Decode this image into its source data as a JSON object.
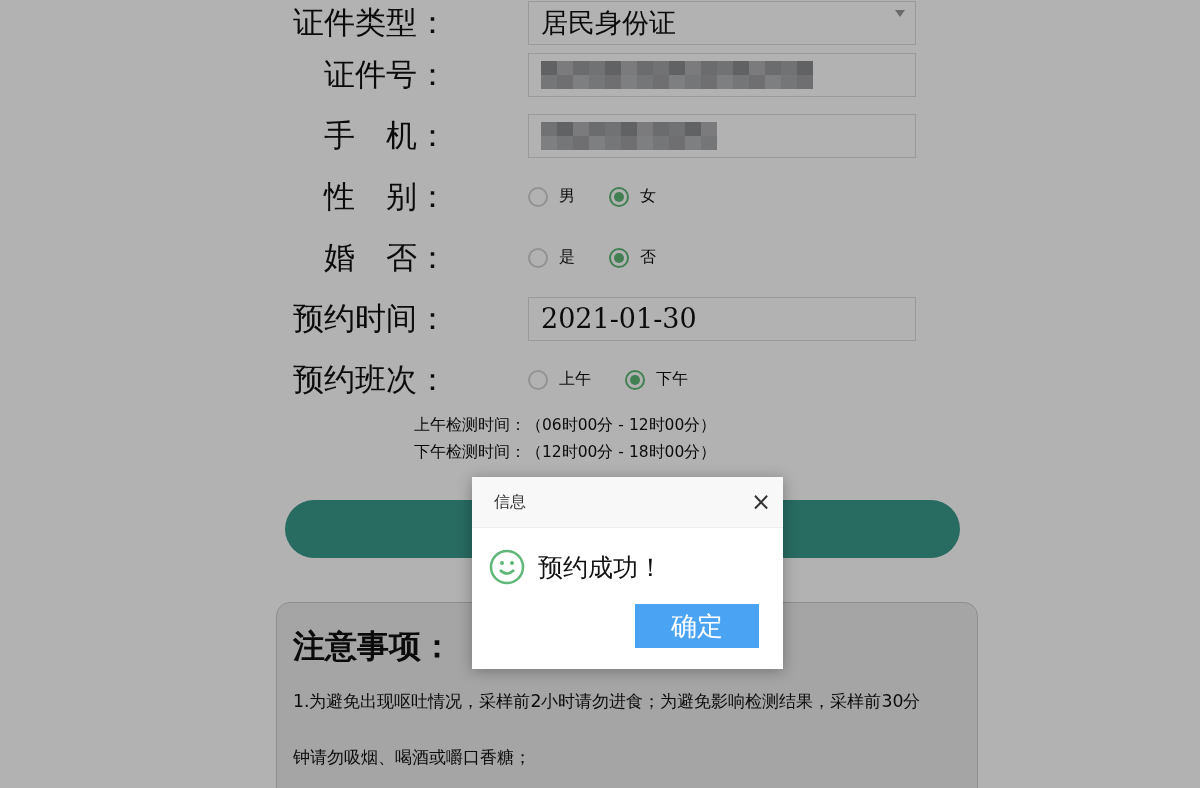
{
  "form": {
    "fields": [
      {
        "label": "证件类型：",
        "kind": "select",
        "value": "居民身份证"
      },
      {
        "label": "证件号：",
        "kind": "redacted"
      },
      {
        "label": "手　机：",
        "kind": "redacted"
      },
      {
        "label": "性　别：",
        "kind": "radio",
        "options": [
          {
            "label": "男",
            "selected": false
          },
          {
            "label": "女",
            "selected": true
          }
        ]
      },
      {
        "label": "婚　否：",
        "kind": "radio",
        "options": [
          {
            "label": "是",
            "selected": false
          },
          {
            "label": "否",
            "selected": true
          }
        ]
      },
      {
        "label": "预约时间：",
        "kind": "text",
        "value": "2021-01-30"
      },
      {
        "label": "预约班次：",
        "kind": "radio",
        "options": [
          {
            "label": "上午",
            "selected": false
          },
          {
            "label": "下午",
            "selected": true
          }
        ]
      }
    ],
    "hours": [
      "上午检测时间：（06时00分 - 12时00分）",
      "下午检测时间：（12时00分 - 18时00分）"
    ]
  },
  "notice": {
    "title": "注意事项：",
    "items": [
      "1.为避免出现呕吐情况，采样前2小时请勿进食；为避免影响检测结果，采样前30分钟请勿吸烟、喝酒或嚼口香糖；"
    ]
  },
  "dialog": {
    "title": "信息",
    "close": "×",
    "message": "预约成功！",
    "button": "确定"
  }
}
